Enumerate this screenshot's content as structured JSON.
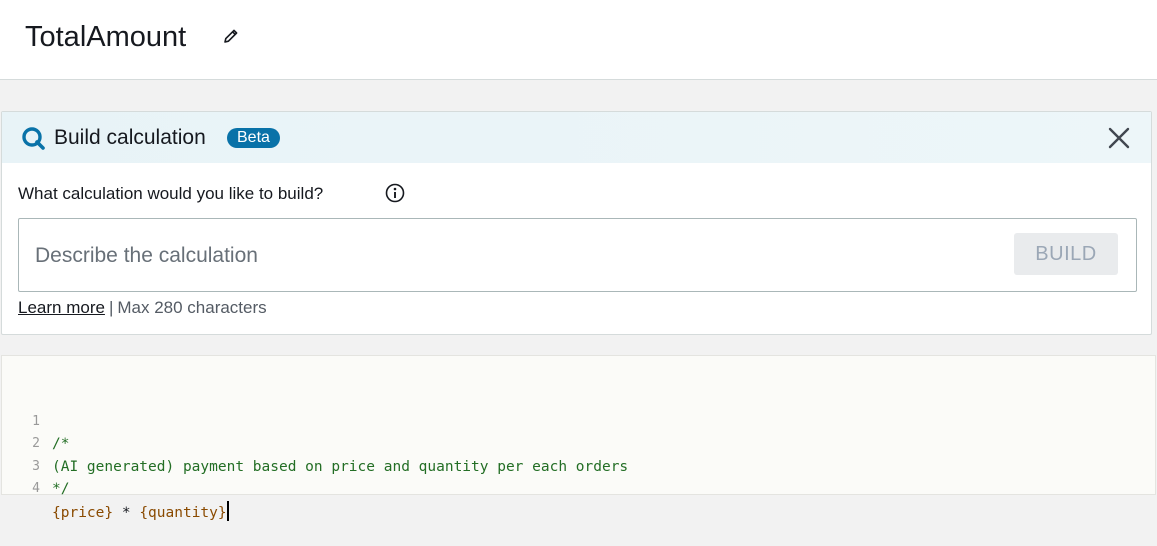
{
  "header": {
    "title": "TotalAmount",
    "edit_icon": "pencil-icon"
  },
  "build_panel": {
    "icon": "q-search-icon",
    "title": "Build calculation",
    "badge": "Beta",
    "close_icon": "close-icon",
    "question": "What calculation would you like to build?",
    "info_icon": "info-icon",
    "input": {
      "value": "",
      "placeholder": "Describe the calculation"
    },
    "build_label": "BUILD",
    "learn_more": "Learn more",
    "separator": "|",
    "max_chars": "Max 280 characters"
  },
  "editor": {
    "lines": [
      {
        "number": "1",
        "text": "/*"
      },
      {
        "number": "2",
        "text": "(AI generated) payment based on price and quantity per each orders"
      },
      {
        "number": "3",
        "text": "*/"
      },
      {
        "number": "4",
        "field1": "{price}",
        "operator": " * ",
        "field2": "{quantity}"
      }
    ]
  },
  "colors": {
    "accent": "#0972a8",
    "comment": "#236e25",
    "field": "#8a4a00"
  }
}
